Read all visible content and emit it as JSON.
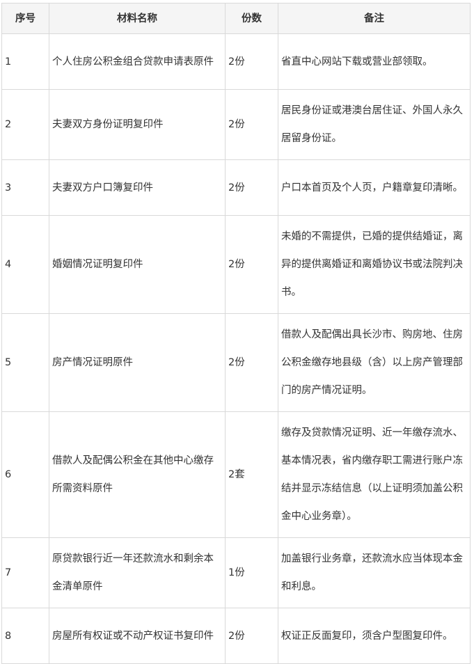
{
  "table": {
    "headers": [
      "序号",
      "材料名称",
      "份数",
      "备注"
    ],
    "rows": [
      {
        "no": "1",
        "name": "个人住房公积金组合贷款申请表原件",
        "copies": "2份",
        "note": "省直中心网站下载或营业部领取。"
      },
      {
        "no": "2",
        "name": "夫妻双方身份证明复印件",
        "copies": "2份",
        "note": "居民身份证或港澳台居住证、外国人永久居留身份证。"
      },
      {
        "no": "3",
        "name": "夫妻双方户口簿复印件",
        "copies": "2份",
        "note": "户口本首页及个人页，户籍章复印清晰。"
      },
      {
        "no": "4",
        "name": "婚姻情况证明复印件",
        "copies": "2份",
        "note": "未婚的不需提供，已婚的提供结婚证，离异的提供离婚证和离婚协议书或法院判决书。"
      },
      {
        "no": "5",
        "name": "房产情况证明原件",
        "copies": "2份",
        "note": "借款人及配偶出具长沙市、购房地、住房公积金缴存地县级（含）以上房产管理部门的房产情况证明。"
      },
      {
        "no": "6",
        "name": "借款人及配偶公积金在其他中心缴存所需资料原件",
        "copies": "2套",
        "note": "缴存及贷款情况证明、近一年缴存流水、基本情况表，省内缴存职工需进行账户冻结并显示冻结信息（以上证明须加盖公积金中心业务章）。"
      },
      {
        "no": "7",
        "name": "原贷款银行近一年还款流水和剩余本金清单原件",
        "copies": "1份",
        "note": "加盖银行业务章，还款流水应当体现本金和利息。"
      },
      {
        "no": "8",
        "name": "房屋所有权证或不动产权证书复印件",
        "copies": "2份",
        "note": "权证正反面复印，须含户型图复印件。"
      }
    ]
  }
}
